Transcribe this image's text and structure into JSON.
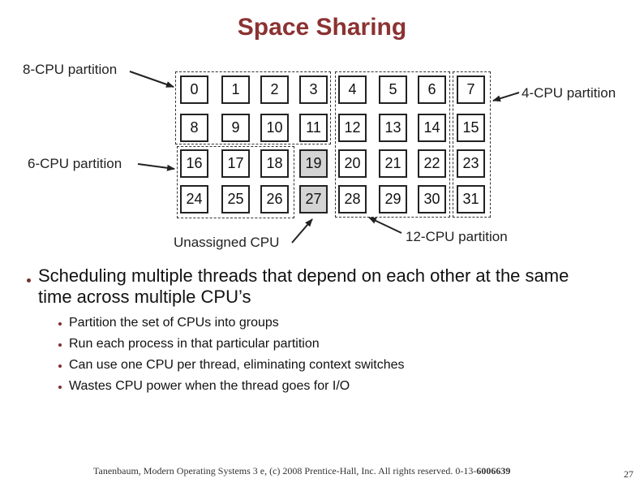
{
  "slide": {
    "title": "Space Sharing",
    "page_number": "27"
  },
  "diagram": {
    "cpus": [
      [
        "0",
        "1",
        "2",
        "3",
        "4",
        "5",
        "6",
        "7"
      ],
      [
        "8",
        "9",
        "10",
        "11",
        "12",
        "13",
        "14",
        "15"
      ],
      [
        "16",
        "17",
        "18",
        "19",
        "20",
        "21",
        "22",
        "23"
      ],
      [
        "24",
        "25",
        "26",
        "27",
        "28",
        "29",
        "30",
        "31"
      ]
    ],
    "unassigned_cpus": [
      "19",
      "27"
    ],
    "labels": {
      "p8": "8-CPU partition",
      "p4": "4-CPU partition",
      "p6": "6-CPU partition",
      "unassigned": "Unassigned CPU",
      "p12": "12-CPU partition"
    }
  },
  "bullets": {
    "main": "Scheduling multiple threads that depend on each other at the same time across multiple CPU’s",
    "sub": [
      "Partition the set of CPUs into groups",
      "Run each process in that particular partition",
      "Can use one CPU per thread, eliminating context switches",
      "Wastes CPU power when the thread goes for I/O"
    ]
  },
  "footer": {
    "text": "Tanenbaum, Modern Operating Systems 3 e, (c) 2008 Prentice-Hall, Inc. All rights reserved. 0-13-",
    "isbn_bold": "6006639"
  }
}
